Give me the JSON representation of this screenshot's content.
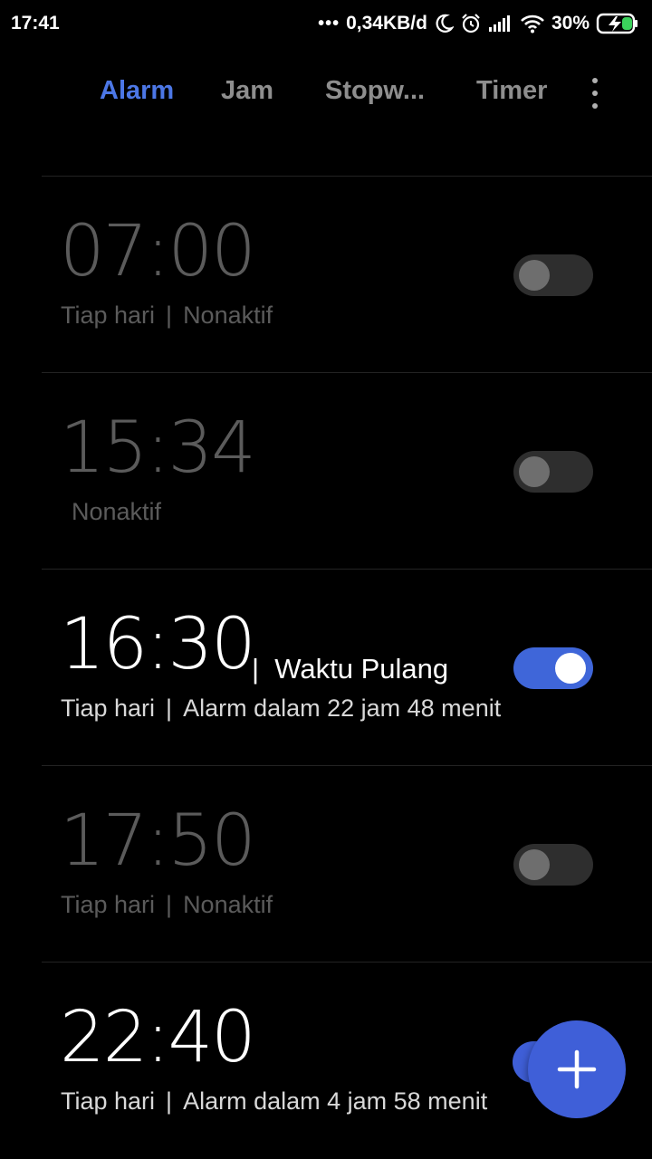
{
  "status_bar": {
    "time": "17:41",
    "dots": "•••",
    "net_speed": "0,34KB/d",
    "battery": "30%",
    "icons": [
      "moon-icon",
      "alarm-clock-icon",
      "signal-icon",
      "wifi-icon",
      "battery-charging-icon"
    ]
  },
  "tabs": [
    {
      "label": "Alarm",
      "active": true
    },
    {
      "label": "Jam",
      "active": false
    },
    {
      "label": "Stopw...",
      "active": false
    },
    {
      "label": "Timer",
      "active": false
    }
  ],
  "alarms": [
    {
      "time": "07:00",
      "repeat": "Tiap hari",
      "separator": "|",
      "status": "Nonaktif",
      "enabled": false
    },
    {
      "time": "15:34",
      "status": "Nonaktif",
      "enabled": false
    },
    {
      "time": "16:30",
      "label_separator": "|",
      "label": "Waktu Pulang",
      "repeat": "Tiap hari",
      "separator": "|",
      "status": "Alarm dalam 22 jam 48 menit",
      "enabled": true
    },
    {
      "time": "17:50",
      "repeat": "Tiap hari",
      "separator": "|",
      "status": "Nonaktif",
      "enabled": false
    },
    {
      "time": "22:40",
      "repeat": "Tiap hari",
      "separator": "|",
      "status": "Alarm dalam 4 jam 58 menit",
      "enabled": true
    }
  ],
  "fab": {
    "icon": "plus-icon"
  },
  "colors": {
    "accent": "#4c77e6",
    "toggle_on": "#3f66d9",
    "toggle_off": "#2e2e2e",
    "background": "#000000",
    "inactive_text": "#5b5b5b"
  }
}
